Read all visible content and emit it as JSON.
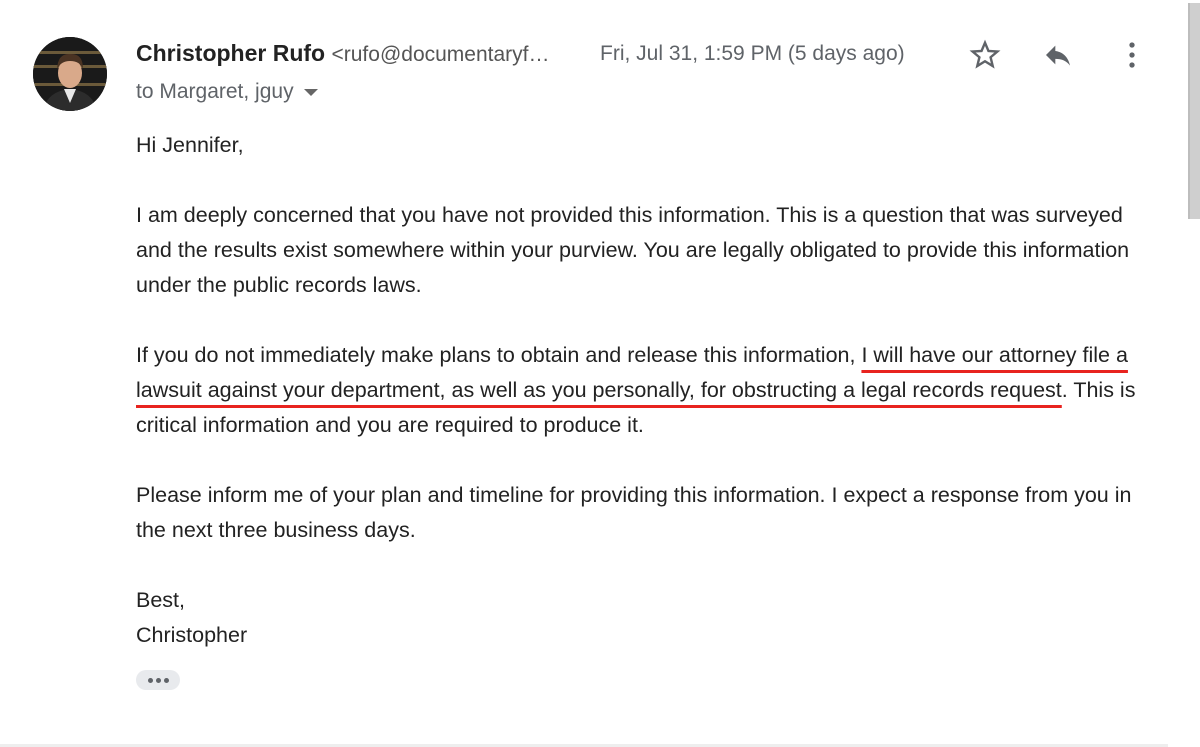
{
  "email": {
    "sender_name": "Christopher Rufo",
    "sender_email": "<rufo@documentaryf…",
    "date": "Fri, Jul 31, 1:59 PM (5 days ago)",
    "recipients": "to Margaret, jguy",
    "icons": {
      "star": "star-icon",
      "reply": "reply-icon",
      "more": "more-vert-icon",
      "expand": "chevron-down-icon",
      "trimmed": "ellipsis-icon"
    },
    "body": {
      "greeting": "Hi Jennifer,",
      "p1": "I am deeply concerned that you have not provided this information. This is a question that was surveyed and the results exist somewhere within your purview. You are legally obligated to provide this information under the public records laws.",
      "p2_before": "If you do not immediately make plans to obtain and release this information, ",
      "p2_highlight": "I will have our attorney file a lawsuit against your department, as well as you personally, for obstructing a legal records request",
      "p2_after": ". This is critical information and you are required to produce it.",
      "p3": "Please inform me of your plan and timeline for providing this information. I expect a response from you in the next three business days.",
      "closing": "Best,",
      "signature": "Christopher"
    },
    "highlight_color": "#e8231f"
  }
}
